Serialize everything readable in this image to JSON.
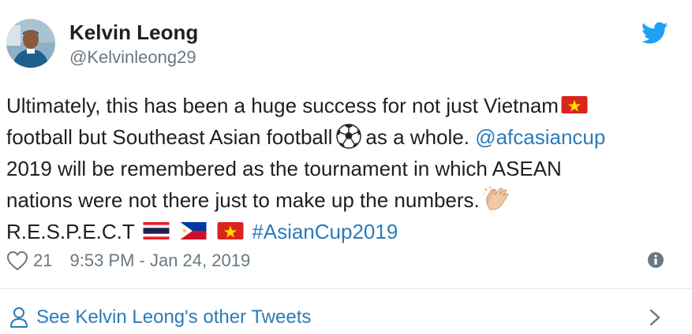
{
  "author": {
    "name": "Kelvin Leong",
    "handle": "@Kelvinleong29"
  },
  "tweet": {
    "line1": "Ultimately, this has been a huge success for not just Vietnam",
    "line2_part1": "football but Southeast Asian football",
    "line2_part2": "as a whole.",
    "mention": "@afcasiancup",
    "line3": "2019 will be remembered as the tournament in which ASEAN",
    "line4": "nations were not there just to make up the numbers.",
    "line5_part1": "R.E.S.P.E.C.T",
    "hashtag": "#AsianCup2019"
  },
  "meta": {
    "likes": "21",
    "timestamp": "9:53 PM - Jan 24, 2019"
  },
  "footer": {
    "see_more": "See Kelvin Leong's other Tweets"
  },
  "icons": {
    "brand": "twitter-bird-icon",
    "like": "heart-icon",
    "info": "info-icon",
    "person": "person-icon",
    "chevron": "chevron-right-icon"
  },
  "colors": {
    "link": "#2b7bb9",
    "muted": "#697882",
    "twitter_blue": "#1da1f2"
  }
}
